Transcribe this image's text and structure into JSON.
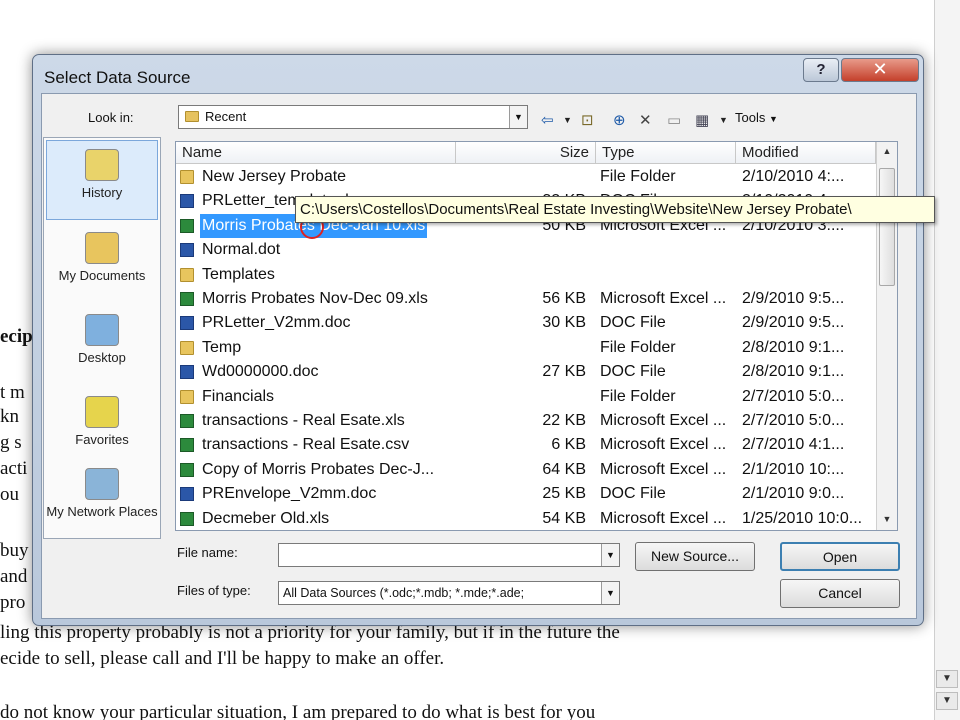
{
  "background_document": {
    "fragments": [
      {
        "text": "ecip"
      },
      {
        "text": "t m"
      },
      {
        "text": "kn"
      },
      {
        "text": "g s"
      },
      {
        "text": "acti"
      },
      {
        "text": "ou"
      },
      {
        "text": "buy"
      },
      {
        "text": "and"
      },
      {
        "text": "pro"
      },
      {
        "text": "ling this property probably is not a priority for your family, but if in the future the"
      },
      {
        "text": "ecide to sell, please call and I'll be happy to make an offer."
      },
      {
        "text": "do not know your particular situation, I am prepared to do what is best for you"
      }
    ]
  },
  "dialog": {
    "title": "Select Data Source",
    "help_label": "?",
    "close_label": "✕",
    "look_in_label": "Look in:",
    "look_in_value": "Recent",
    "tools_label": "Tools",
    "places": [
      {
        "label": "History",
        "icon": "history-icon",
        "selected": true
      },
      {
        "label": "My Documents",
        "icon": "my-documents-icon",
        "selected": false
      },
      {
        "label": "Desktop",
        "icon": "desktop-icon",
        "selected": false
      },
      {
        "label": "Favorites",
        "icon": "favorites-icon",
        "selected": false
      },
      {
        "label": "My Network Places",
        "icon": "network-places-icon",
        "selected": false
      }
    ],
    "columns": {
      "name": "Name",
      "size": "Size",
      "type": "Type",
      "modified": "Modified"
    },
    "files": [
      {
        "name": "New Jersey Probate",
        "size": "",
        "type": "File Folder",
        "modified": "2/10/2010 4:...",
        "icon": "folder"
      },
      {
        "name": "PRLetter_template.doc",
        "size": "32 KB",
        "type": "DOC File",
        "modified": "2/10/2010 4:...",
        "icon": "doc"
      },
      {
        "name": "Morris Probates Dec-Jan 10.xls",
        "size": "50 KB",
        "type": "Microsoft Excel ...",
        "modified": "2/10/2010 3:...",
        "icon": "xls",
        "selected": true
      },
      {
        "name": "Normal.dot",
        "size": "",
        "type": "",
        "modified": "",
        "icon": "doc"
      },
      {
        "name": "Templates",
        "size": "",
        "type": "",
        "modified": "",
        "icon": "folder"
      },
      {
        "name": "Morris Probates Nov-Dec 09.xls",
        "size": "56 KB",
        "type": "Microsoft Excel ...",
        "modified": "2/9/2010 9:5...",
        "icon": "xls"
      },
      {
        "name": "PRLetter_V2mm.doc",
        "size": "30 KB",
        "type": "DOC File",
        "modified": "2/9/2010 9:5...",
        "icon": "doc"
      },
      {
        "name": "Temp",
        "size": "",
        "type": "File Folder",
        "modified": "2/8/2010 9:1...",
        "icon": "folder"
      },
      {
        "name": "Wd0000000.doc",
        "size": "27 KB",
        "type": "DOC File",
        "modified": "2/8/2010 9:1...",
        "icon": "doc"
      },
      {
        "name": "Financials",
        "size": "",
        "type": "File Folder",
        "modified": "2/7/2010 5:0...",
        "icon": "folder"
      },
      {
        "name": "transactions - Real Esate.xls",
        "size": "22 KB",
        "type": "Microsoft Excel ...",
        "modified": "2/7/2010 5:0...",
        "icon": "xls"
      },
      {
        "name": "transactions - Real Esate.csv",
        "size": "6 KB",
        "type": "Microsoft Excel ...",
        "modified": "2/7/2010 4:1...",
        "icon": "xls"
      },
      {
        "name": "Copy of Morris Probates Dec-J...",
        "size": "64 KB",
        "type": "Microsoft Excel ...",
        "modified": "2/1/2010 10:...",
        "icon": "xls"
      },
      {
        "name": "PREnvelope_V2mm.doc",
        "size": "25 KB",
        "type": "DOC File",
        "modified": "2/1/2010 9:0...",
        "icon": "doc"
      },
      {
        "name": "Decmeber Old.xls",
        "size": "54 KB",
        "type": "Microsoft Excel ...",
        "modified": "1/25/2010 10:0...",
        "icon": "xls"
      }
    ],
    "tooltip": "C:\\Users\\Costellos\\Documents\\Real Estate Investing\\Website\\New Jersey Probate\\",
    "file_name_label": "File name:",
    "file_name_value": "",
    "files_of_type_label": "Files of type:",
    "files_of_type_value": "All Data Sources (*.odc;*.mdb; *.mde;*.ade;",
    "new_source_label": "New Source...",
    "open_label": "Open",
    "cancel_label": "Cancel"
  }
}
